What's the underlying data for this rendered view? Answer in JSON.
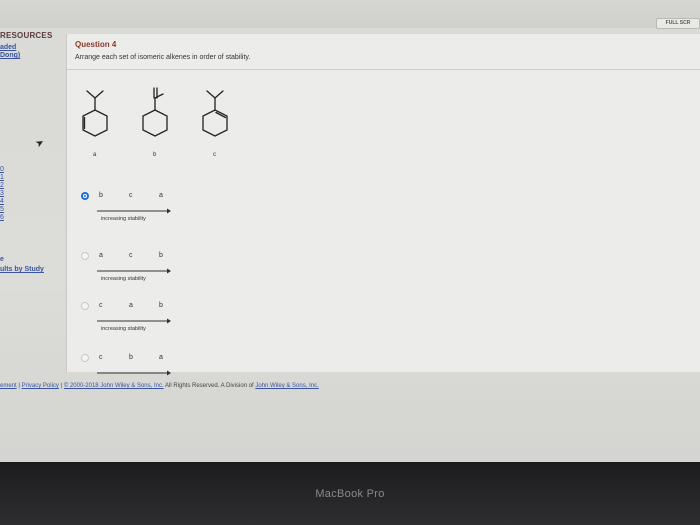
{
  "topbar": {
    "fullscreen_label": "FULL SCR"
  },
  "sidebar": {
    "title": "RESOURCES",
    "link1": "aded",
    "link2": "Dong)",
    "question_numbers": [
      "0",
      "1",
      "2",
      "3",
      "4",
      "5",
      "6"
    ],
    "study_symbol": "e",
    "study_link": "ults by Study"
  },
  "question": {
    "title": "Question 4",
    "prompt": "Arrange each set of isomeric alkenes in order of stability.",
    "molecule_labels": [
      "a",
      "b",
      "c"
    ]
  },
  "options": [
    {
      "order": [
        "b",
        "c",
        "a"
      ],
      "caption": "increasing stability",
      "selected": true
    },
    {
      "order": [
        "a",
        "c",
        "b"
      ],
      "caption": "increasing stability",
      "selected": false
    },
    {
      "order": [
        "c",
        "a",
        "b"
      ],
      "caption": "increasing stability",
      "selected": false
    },
    {
      "order": [
        "c",
        "b",
        "a"
      ],
      "caption": "",
      "selected": false
    }
  ],
  "footer": {
    "prefix": "ement",
    "sep1": "|",
    "privacy": "Privacy Policy",
    "sep2": "|",
    "copyright": "© 2000-2018 John Wiley & Sons, Inc.",
    "rights": " All Rights Reserved. A Division of ",
    "company": "John Wiley & Sons, Inc."
  },
  "device": {
    "brand": "MacBook Pro"
  },
  "colors": {
    "accent": "#1b6fd6",
    "question_title": "#8a3b2a",
    "link": "#3b55a0"
  }
}
